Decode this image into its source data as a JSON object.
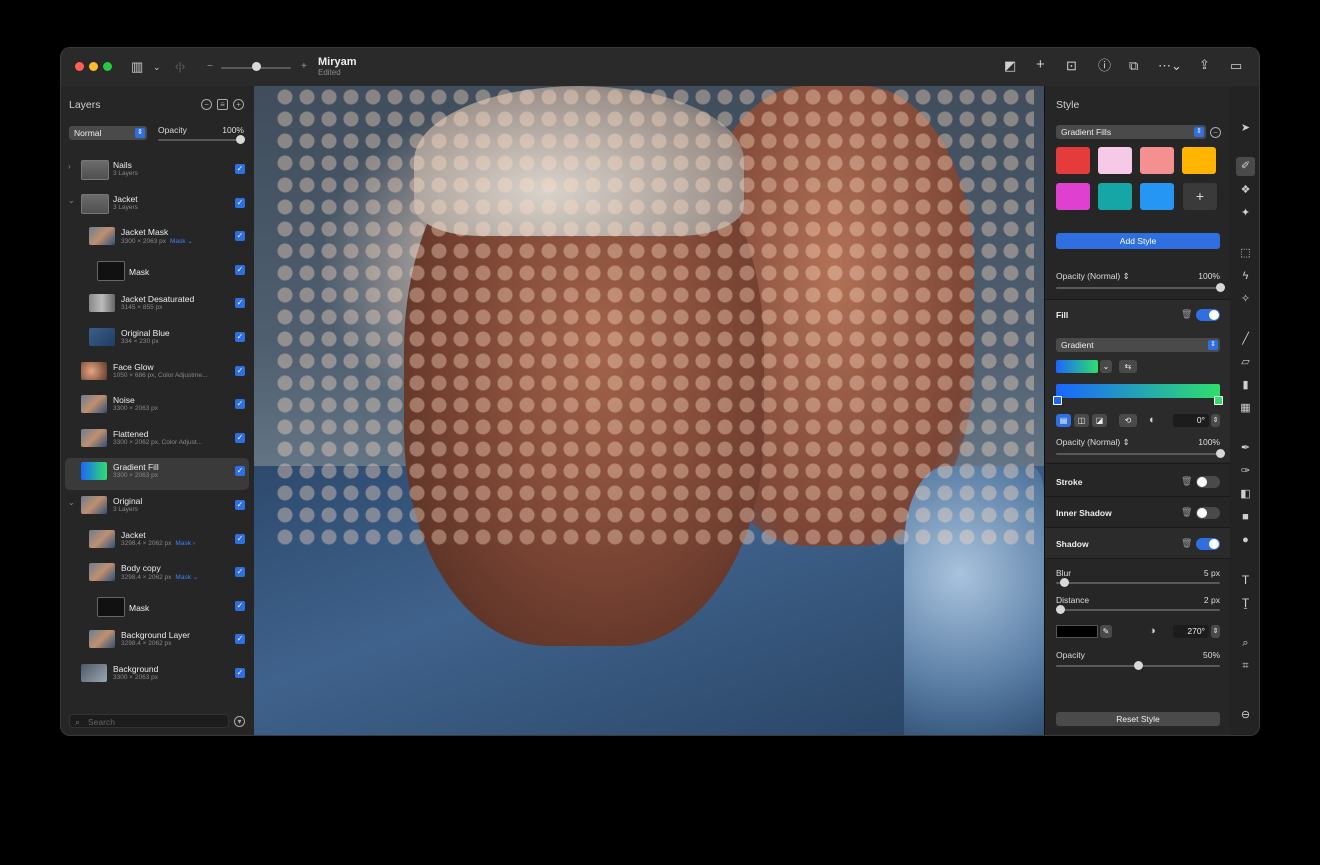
{
  "window": {
    "doc_title": "Miryam",
    "doc_status": "Edited",
    "traffic_colors": [
      "#ff5f57",
      "#febc2e",
      "#28c840"
    ]
  },
  "layers_panel": {
    "title": "Layers",
    "blend_mode": "Normal",
    "opacity_label": "Opacity",
    "opacity_value": "100%",
    "opacity_fraction": 1.0,
    "search_placeholder": "Search",
    "layers": [
      {
        "name": "Nails",
        "meta": "3 Layers",
        "tag": "",
        "indent": 0,
        "disclosure": ">",
        "thumb": "folder"
      },
      {
        "name": "Jacket",
        "meta": "3 Layers",
        "tag": "",
        "indent": 0,
        "disclosure": "v",
        "thumb": "folder"
      },
      {
        "name": "Jacket Mask",
        "meta": "3300 × 2063 px",
        "tag": "Mask ⌄",
        "indent": 1,
        "disclosure": "",
        "thumb": "photo"
      },
      {
        "name": "Mask",
        "meta": "",
        "tag": "",
        "indent": 2,
        "disclosure": "",
        "thumb": "mask"
      },
      {
        "name": "Jacket Desaturated",
        "meta": "3145 × 855 px",
        "tag": "",
        "indent": 1,
        "disclosure": "",
        "thumb": "desat"
      },
      {
        "name": "Original Blue",
        "meta": "334 × 230 px",
        "tag": "",
        "indent": 1,
        "disclosure": "",
        "thumb": "blue"
      },
      {
        "name": "Face Glow",
        "meta": "1050 × 686 px, Color Adjustme...",
        "tag": "",
        "indent": 0,
        "disclosure": "",
        "thumb": "glow"
      },
      {
        "name": "Noise",
        "meta": "3300 × 2063 px",
        "tag": "",
        "indent": 0,
        "disclosure": "",
        "thumb": "photo"
      },
      {
        "name": "Flattened",
        "meta": "3300 × 2062 px, Color Adjust...",
        "tag": "",
        "indent": 0,
        "disclosure": "",
        "thumb": "photo"
      },
      {
        "name": "Gradient Fill",
        "meta": "3300 × 2063 px",
        "tag": "",
        "indent": 0,
        "disclosure": "",
        "thumb": "gradient",
        "selected": true
      },
      {
        "name": "Original",
        "meta": "3 Layers",
        "tag": "",
        "indent": 0,
        "disclosure": "v",
        "thumb": "photo"
      },
      {
        "name": "Jacket",
        "meta": "3298.4 × 2062 px",
        "tag": "Mask ›",
        "indent": 1,
        "disclosure": "",
        "thumb": "photo"
      },
      {
        "name": "Body copy",
        "meta": "3298.4 × 2062 px",
        "tag": "Mask ⌄",
        "indent": 1,
        "disclosure": "",
        "thumb": "photo"
      },
      {
        "name": "Mask",
        "meta": "",
        "tag": "",
        "indent": 2,
        "disclosure": "",
        "thumb": "mask"
      },
      {
        "name": "Background Layer",
        "meta": "3298.4 × 2062 px",
        "tag": "",
        "indent": 1,
        "disclosure": "",
        "thumb": "photo"
      },
      {
        "name": "Background",
        "meta": "3300 × 2063 px",
        "tag": "",
        "indent": 0,
        "disclosure": "",
        "thumb": "bg"
      }
    ]
  },
  "style_panel": {
    "title": "Style",
    "preset_select": "Gradient Fills",
    "swatches": [
      "#e53b3b",
      "#f6c9e6",
      "#f49090",
      "#ffb400",
      "#e040d0",
      "#16a6a6",
      "#2596f3"
    ],
    "add_style_label": "Add Style",
    "opacity_label": "Opacity (Normal) ⇕",
    "opacity_value": "100%",
    "opacity_fraction": 1.0,
    "fill": {
      "label": "Fill",
      "enabled": true,
      "type": "Gradient",
      "gradient_colors": [
        "#1a66ff",
        "#2ee06a"
      ],
      "angle": "0°",
      "opacity_label": "Opacity (Normal) ⇕",
      "opacity_value": "100%",
      "opacity_fraction": 1.0
    },
    "stroke": {
      "label": "Stroke",
      "enabled": false
    },
    "inner_shadow": {
      "label": "Inner Shadow",
      "enabled": false
    },
    "shadow": {
      "label": "Shadow",
      "enabled": true,
      "blur_label": "Blur",
      "blur_value": "5 px",
      "blur_fraction": 0.05,
      "distance_label": "Distance",
      "distance_value": "2 px",
      "distance_fraction": 0.03,
      "color": "#000000",
      "angle": "270°",
      "opacity_label": "Opacity",
      "opacity_value": "50%",
      "opacity_fraction": 0.5
    },
    "reset_label": "Reset Style"
  },
  "colors": {
    "accent": "#2f6fe0",
    "panel_bg": "#262626"
  }
}
